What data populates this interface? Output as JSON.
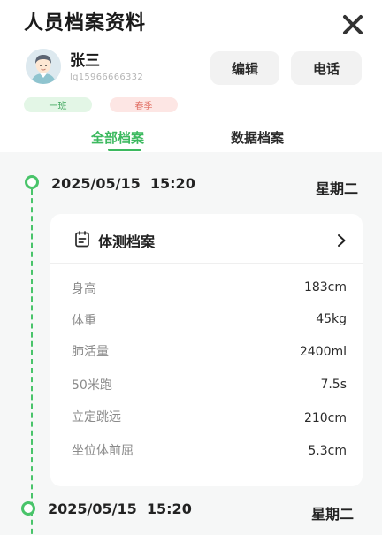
{
  "header": {
    "title": "人员档案资料",
    "close_icon": "close-icon"
  },
  "user": {
    "name": "张三",
    "id": "lq15966666332",
    "avatar_icon": "user-avatar-icon"
  },
  "actions": {
    "edit_label": "编辑",
    "call_label": "电话"
  },
  "tags": {
    "class_label": "一班",
    "season_label": "春季"
  },
  "tabs": [
    {
      "label": "全部档案",
      "active": true
    },
    {
      "label": "数据档案",
      "active": false
    }
  ],
  "timeline": [
    {
      "date": "2025/05/15  15:20",
      "weekday": "星期二"
    },
    {
      "date": "2025/05/15  15:20",
      "weekday": "星期二"
    }
  ],
  "record": {
    "title": "体测档案",
    "icon": "clipboard-icon",
    "chevron_icon": "chevron-right-icon",
    "metrics": [
      {
        "label": "身高",
        "value": "183cm"
      },
      {
        "label": "体重",
        "value": "45kg"
      },
      {
        "label": "肺活量",
        "value": "2400ml"
      },
      {
        "label": "50米跑",
        "value": "7.5s"
      },
      {
        "label": "立定跳远",
        "value": "210cm"
      },
      {
        "label": "坐位体前屈",
        "value": "5.3cm"
      }
    ]
  },
  "colors": {
    "accent": "#3cb95f",
    "timeline": "#49c46a",
    "tag_class_bg": "#e3f6e6",
    "tag_season_bg": "#fde6e4"
  }
}
